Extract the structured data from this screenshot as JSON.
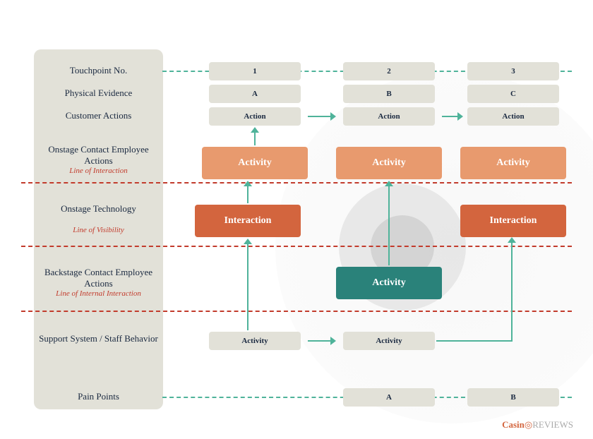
{
  "labels": {
    "touchpoint": "Touchpoint No.",
    "evidence": "Physical Evidence",
    "customer": "Customer Actions",
    "onstage_emp": "Onstage Contact Employee Actions",
    "onstage_emp_sub": "Line of Interaction",
    "onstage_tech": "Onstage Technology",
    "onstage_tech_sub": "Line of Visibility",
    "backstage": "Backstage Contact Employee Actions",
    "backstage_sub": "Line of Internal Interaction",
    "support": "Support System / Staff Behavior",
    "pain": "Pain Points"
  },
  "row_touchpoint": {
    "c1": "1",
    "c2": "2",
    "c3": "3"
  },
  "row_evidence": {
    "c1": "A",
    "c2": "B",
    "c3": "C"
  },
  "row_customer": {
    "c1": "Action",
    "c2": "Action",
    "c3": "Action"
  },
  "row_onstage_emp": {
    "c1": "Activity",
    "c2": "Activity",
    "c3": "Activity"
  },
  "row_onstage_tech": {
    "c1": "Interaction",
    "c3": "Interaction"
  },
  "row_backstage": {
    "c2": "Activity"
  },
  "row_support": {
    "c1": "Activity",
    "c2": "Activity"
  },
  "row_pain": {
    "c2": "A",
    "c3": "B"
  },
  "logo": {
    "brand": "Casin",
    "brand2": "REVIEWS"
  }
}
